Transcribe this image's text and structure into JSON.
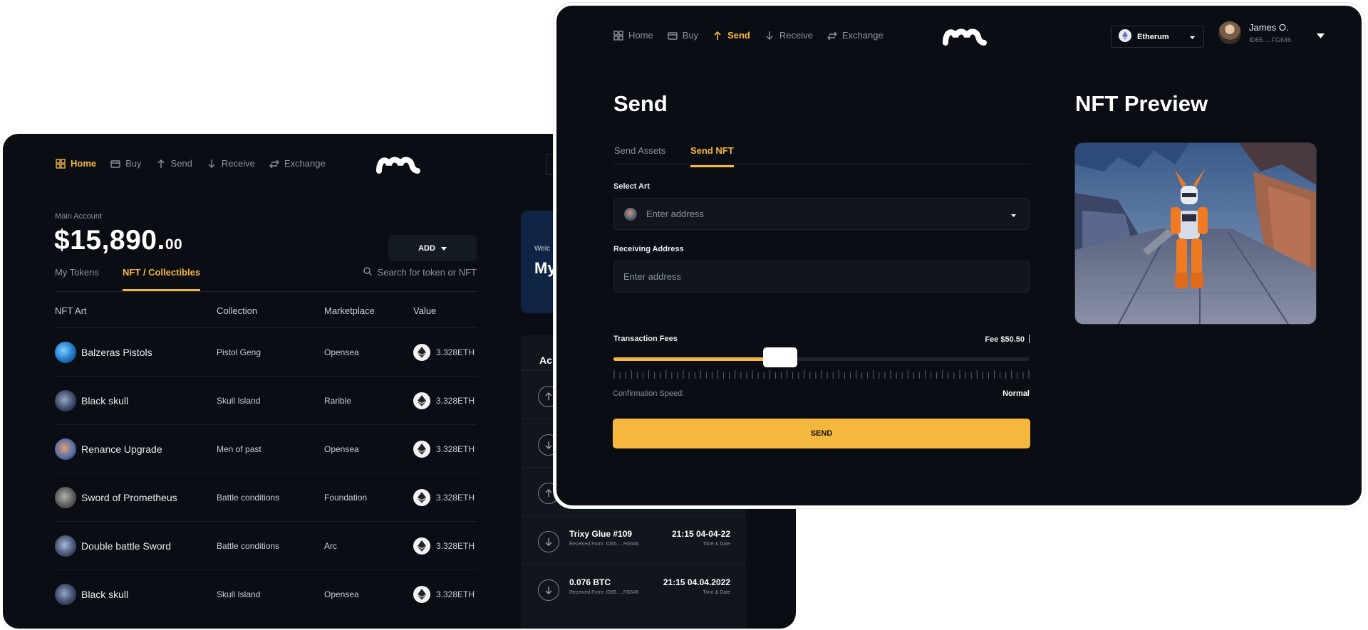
{
  "home_window": {
    "nav": [
      {
        "label": "Home",
        "icon": "grid-icon",
        "active": true
      },
      {
        "label": "Buy",
        "icon": "card-icon",
        "active": false
      },
      {
        "label": "Send",
        "icon": "arrow-up-icon",
        "active": false
      },
      {
        "label": "Receive",
        "icon": "arrow-down-icon",
        "active": false
      },
      {
        "label": "Exchange",
        "icon": "swap-icon",
        "active": false
      }
    ],
    "account_label": "Main Account",
    "balance_main": "$15,890.",
    "balance_cents": "00",
    "add_button": "ADD",
    "tabs": [
      "My Tokens",
      "NFT / Collectibles"
    ],
    "active_tab": "NFT / Collectibles",
    "search_placeholder": "Search for token or NFT",
    "table": {
      "headers": [
        "NFT Art",
        "Collection",
        "Marketplace",
        "Value"
      ],
      "rows": [
        {
          "name": "Balzeras Pistols",
          "collection": "Pistol Geng",
          "marketplace": "Opensea",
          "value": "3.328ETH"
        },
        {
          "name": "Black skull",
          "collection": "Skull Island",
          "marketplace": "Rarible",
          "value": "3.328ETH"
        },
        {
          "name": "Renance Upgrade",
          "collection": "Men of past",
          "marketplace": "Opensea",
          "value": "3.328ETH"
        },
        {
          "name": "Sword of Prometheus",
          "collection": "Battle conditions",
          "marketplace": "Foundation",
          "value": "3.328ETH"
        },
        {
          "name": "Double battle Sword",
          "collection": "Battle conditions",
          "marketplace": "Arc",
          "value": "3.328ETH"
        },
        {
          "name": "Black skull",
          "collection": "Skull Island",
          "marketplace": "Opensea",
          "value": "3.328ETH"
        }
      ]
    },
    "welcome_card": {
      "line1": "Welc",
      "line2": "My"
    },
    "activity": {
      "title": "Ac",
      "items": [
        {
          "icon": "arrow-up-circle-icon",
          "title": "",
          "sub": "",
          "time": "",
          "time_sub": ""
        },
        {
          "icon": "arrow-down-circle-icon",
          "title": "",
          "sub": "",
          "time": "",
          "time_sub": ""
        },
        {
          "icon": "arrow-up-circle-icon",
          "title": "",
          "sub": "",
          "time": "",
          "time_sub": ""
        },
        {
          "icon": "arrow-down-circle-icon",
          "title": "Trixy Glue #109",
          "sub": "Received From: ID65.....FG646",
          "time": "21:15 04-04-22",
          "time_sub": "Time & Date"
        },
        {
          "icon": "arrow-down-circle-icon",
          "title": "0.076 BTC",
          "sub": "Received From: ID65.....FG646",
          "time": "21:15 04.04.2022",
          "time_sub": "Time & Date"
        }
      ]
    }
  },
  "send_window": {
    "nav": [
      {
        "label": "Home",
        "icon": "grid-icon",
        "active": false
      },
      {
        "label": "Buy",
        "icon": "card-icon",
        "active": false
      },
      {
        "label": "Send",
        "icon": "arrow-up-icon",
        "active": true
      },
      {
        "label": "Receive",
        "icon": "arrow-down-icon",
        "active": false
      },
      {
        "label": "Exchange",
        "icon": "swap-icon",
        "active": false
      }
    ],
    "network": "Etherum",
    "user": {
      "name": "James O.",
      "id": "ID65.....FG646"
    },
    "title": "Send",
    "tabs": [
      "Send Assets",
      "Send NFT"
    ],
    "active_tab": "Send NFT",
    "select_art_label": "Select Art",
    "select_art_placeholder": "Enter address",
    "receiving_label": "Receiving Address",
    "receiving_placeholder": "Enter address",
    "fees_label": "Transaction Fees",
    "fee_value": "Fee $50.50",
    "fee_slider_fraction": 0.4,
    "speed_label": "Confirmation Speed:",
    "speed_value": "Normal",
    "send_button": "SEND",
    "preview_title": "NFT Preview"
  },
  "colors": {
    "accent": "#f5b73e",
    "background": "#0a0e14",
    "panel": "#11161d",
    "muted": "#8a929c"
  }
}
